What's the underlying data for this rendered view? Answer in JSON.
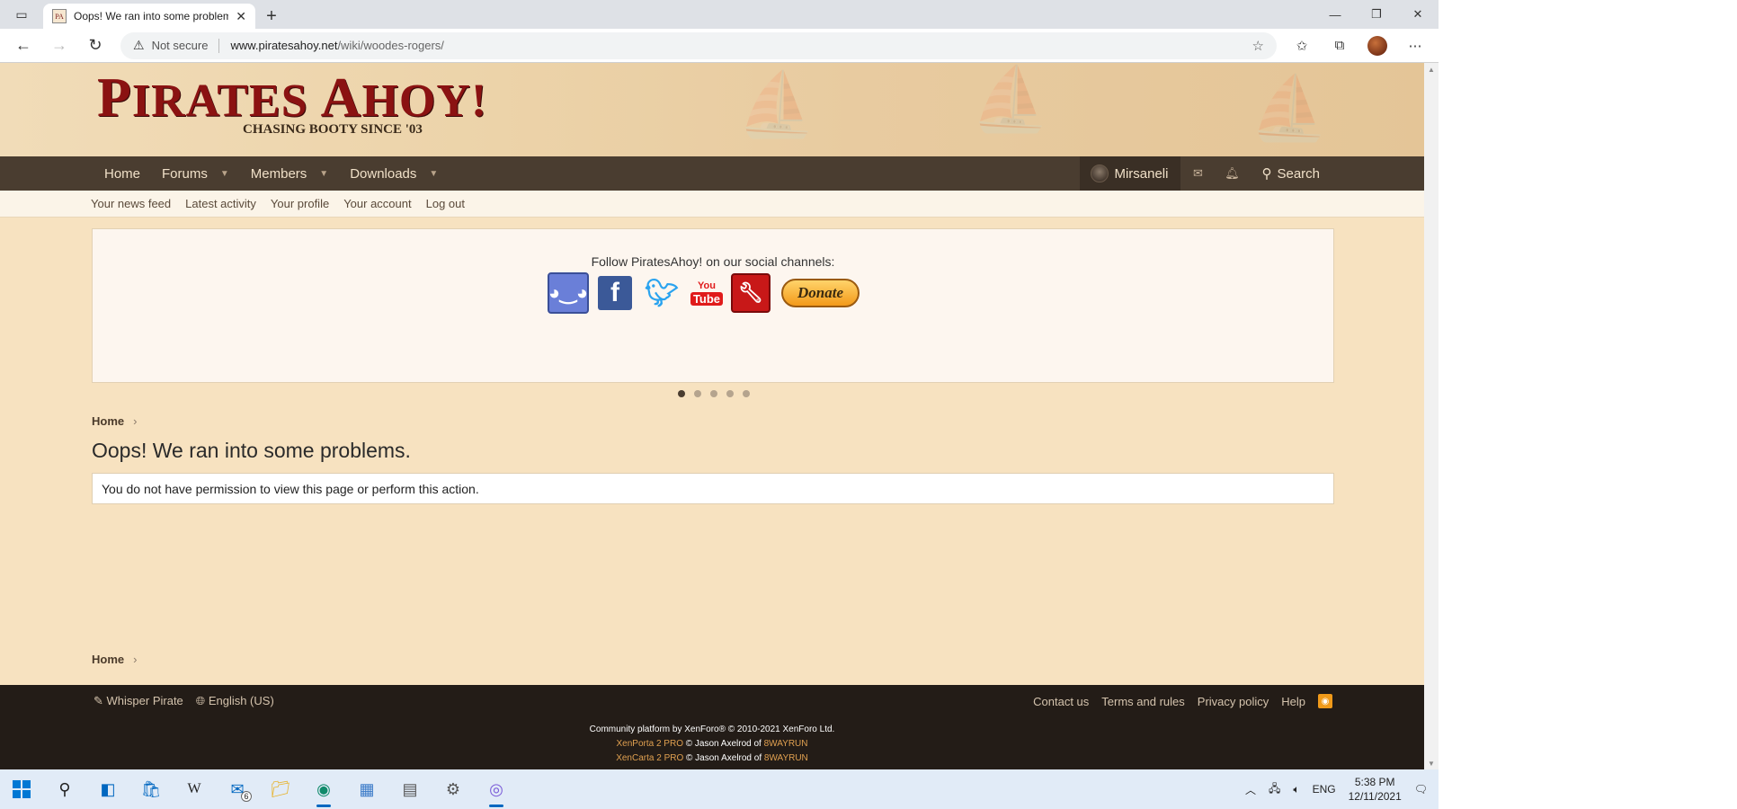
{
  "browser": {
    "tab_title": "Oops! We ran into some problems.",
    "favicon_text": "PA",
    "security_label": "Not secure",
    "url_domain": "www.piratesahoy.net",
    "url_path": "/wiki/woodes-rogers/"
  },
  "site": {
    "logo_main_1": "P",
    "logo_main_2": "IRATES ",
    "logo_main_3": "A",
    "logo_main_4": "HOY!",
    "logo_tagline": "CHASING BOOTY SINCE '03",
    "nav": {
      "home": "Home",
      "forums": "Forums",
      "members": "Members",
      "downloads": "Downloads",
      "user": "Mirsaneli",
      "search": "Search"
    },
    "subnav": [
      "Your news feed",
      "Latest activity",
      "Your profile",
      "Your account",
      "Log out"
    ],
    "notice": {
      "text": "Follow PiratesAhoy! on our social channels:",
      "youtube_1": "You",
      "youtube_2": "Tube",
      "donate": "Donate"
    },
    "breadcrumb_top": "Home",
    "page_title": "Oops! We ran into some problems.",
    "error_message": "You do not have permission to view this page or perform this action.",
    "breadcrumb_bottom": "Home",
    "footer": {
      "whisper": "Whisper Pirate",
      "language": "English (US)",
      "contact": "Contact us",
      "terms": "Terms and rules",
      "privacy": "Privacy policy",
      "help": "Help",
      "line1": "Community platform by XenForo® © 2010-2021 XenForo Ltd.",
      "line2_product": "XenPorta 2 PRO",
      "line2_mid": " © Jason Axelrod of ",
      "line2_company": "8WAYRUN",
      "line3_product": "XenCarta 2 PRO",
      "line3_mid": " © Jason Axelrod of ",
      "line3_company": "8WAYRUN"
    }
  },
  "taskbar": {
    "mail_badge": "6",
    "language": "ENG",
    "time": "5:38 PM",
    "date": "12/11/2021"
  },
  "colors": {
    "page_bg": "#f7e2c0",
    "navbar": "#4a3d30",
    "footer": "#231c17",
    "logo_red": "#8b1212"
  }
}
